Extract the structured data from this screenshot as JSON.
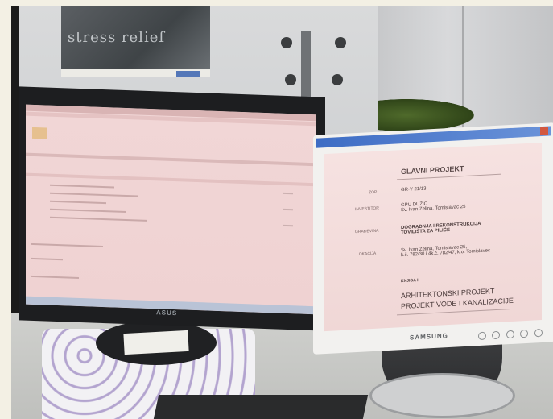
{
  "photo": {
    "poster_text": "stress relief",
    "left_monitor_brand": "ASUS",
    "right_monitor_brand": "SAMSUNG"
  },
  "document": {
    "title": "GLAVNI PROJEKT",
    "rows": [
      {
        "label": "ZOP",
        "value": "GR-Y-21/13"
      },
      {
        "label": "INVESTITOR",
        "value": "GPU DUŽIĆ\nSv. Ivan Zelina, Tomislavac 25"
      },
      {
        "label": "GRAĐEVINA",
        "value": "DOGRADNJA I REKONSTRUKCIJA\nTOVILIŠTA ZA PILIĆE"
      },
      {
        "label": "LOKACIJA",
        "value": "Sv. Ivan Zelina, Tomislavac 25,\nk.č. 782/30 i 4k.č. 782/47, k.o. Tomislavec"
      }
    ],
    "section_label": "KNJIGA I",
    "section_lines": [
      "ARHITEKTONSKI  PROJEKT",
      "PROJEKT VODE I KANALIZACIJE"
    ]
  },
  "colors": {
    "screen_pink": "#f1d6d6",
    "windows_blue": "#3d6cc4"
  }
}
